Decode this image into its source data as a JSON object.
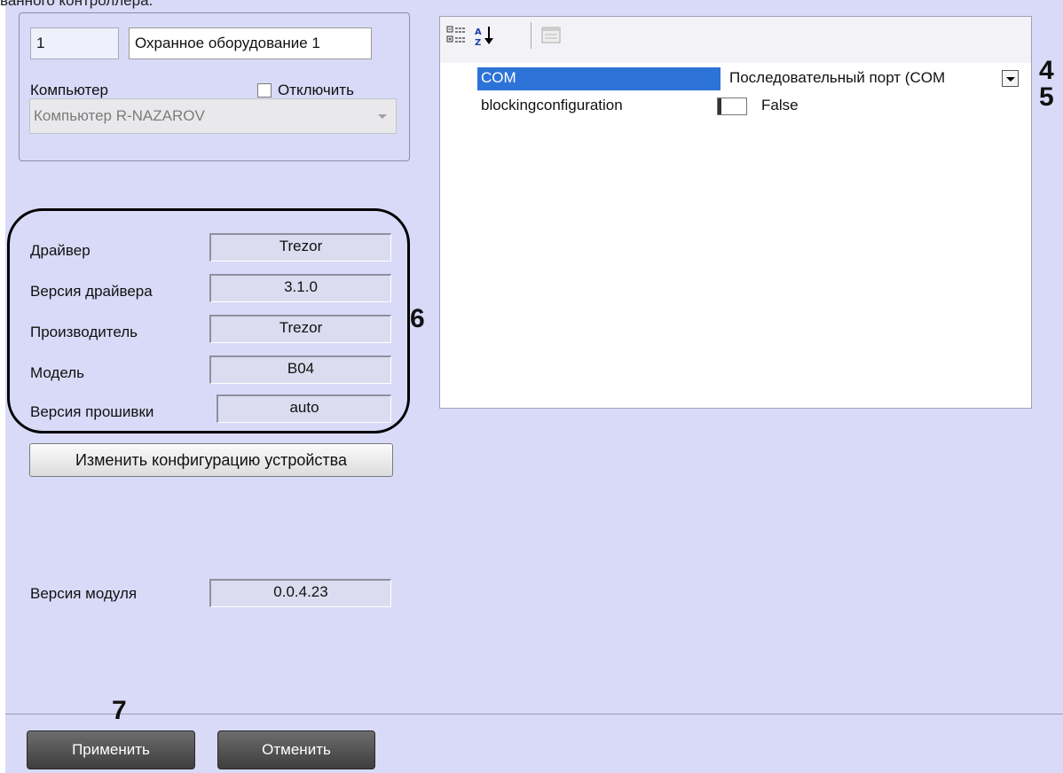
{
  "caption_cut": "ванного контроллера.",
  "object": {
    "id": "1",
    "name": "Охранное оборудование 1"
  },
  "computer": {
    "label": "Компьютер",
    "disable_label": "Отключить",
    "selected": "Компьютер R-NAZAROV"
  },
  "property_grid": {
    "rows": [
      {
        "name": "COM",
        "value": "Последовательный порт (COM"
      },
      {
        "name": "blockingconfiguration",
        "value": "False"
      }
    ]
  },
  "driver_info": [
    {
      "label": "Драйвер",
      "value": "Trezor"
    },
    {
      "label": "Версия драйвера",
      "value": "3.1.0"
    },
    {
      "label": "Производитель",
      "value": "Trezor"
    },
    {
      "label": "Модель",
      "value": "B04"
    },
    {
      "label": "Версия прошивки",
      "value": "auto"
    }
  ],
  "change_config_label": "Изменить конфигурацию устройства",
  "module_version": {
    "label": "Версия модуля",
    "value": "0.0.4.23"
  },
  "buttons": {
    "apply": "Применить",
    "cancel": "Отменить"
  },
  "callouts": {
    "c4": "4",
    "c5": "5",
    "c6": "6",
    "c7": "7"
  }
}
